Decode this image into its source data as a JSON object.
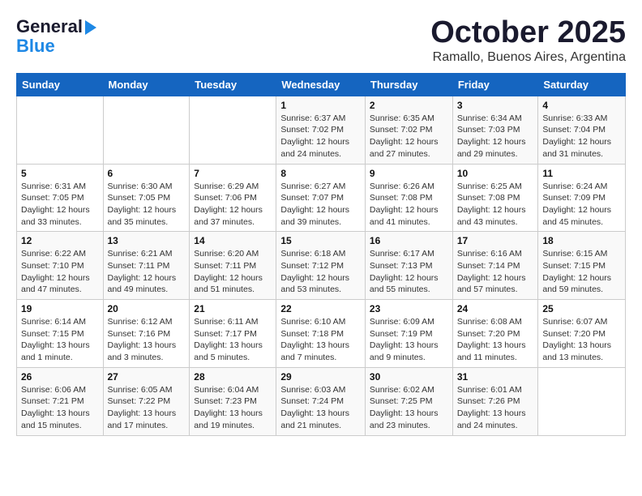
{
  "logo": {
    "line1": "General",
    "line2": "Blue"
  },
  "title": "October 2025",
  "location": "Ramallo, Buenos Aires, Argentina",
  "days_of_week": [
    "Sunday",
    "Monday",
    "Tuesday",
    "Wednesday",
    "Thursday",
    "Friday",
    "Saturday"
  ],
  "weeks": [
    [
      {
        "day": "",
        "info": ""
      },
      {
        "day": "",
        "info": ""
      },
      {
        "day": "",
        "info": ""
      },
      {
        "day": "1",
        "info": "Sunrise: 6:37 AM\nSunset: 7:02 PM\nDaylight: 12 hours and 24 minutes."
      },
      {
        "day": "2",
        "info": "Sunrise: 6:35 AM\nSunset: 7:02 PM\nDaylight: 12 hours and 27 minutes."
      },
      {
        "day": "3",
        "info": "Sunrise: 6:34 AM\nSunset: 7:03 PM\nDaylight: 12 hours and 29 minutes."
      },
      {
        "day": "4",
        "info": "Sunrise: 6:33 AM\nSunset: 7:04 PM\nDaylight: 12 hours and 31 minutes."
      }
    ],
    [
      {
        "day": "5",
        "info": "Sunrise: 6:31 AM\nSunset: 7:05 PM\nDaylight: 12 hours and 33 minutes."
      },
      {
        "day": "6",
        "info": "Sunrise: 6:30 AM\nSunset: 7:05 PM\nDaylight: 12 hours and 35 minutes."
      },
      {
        "day": "7",
        "info": "Sunrise: 6:29 AM\nSunset: 7:06 PM\nDaylight: 12 hours and 37 minutes."
      },
      {
        "day": "8",
        "info": "Sunrise: 6:27 AM\nSunset: 7:07 PM\nDaylight: 12 hours and 39 minutes."
      },
      {
        "day": "9",
        "info": "Sunrise: 6:26 AM\nSunset: 7:08 PM\nDaylight: 12 hours and 41 minutes."
      },
      {
        "day": "10",
        "info": "Sunrise: 6:25 AM\nSunset: 7:08 PM\nDaylight: 12 hours and 43 minutes."
      },
      {
        "day": "11",
        "info": "Sunrise: 6:24 AM\nSunset: 7:09 PM\nDaylight: 12 hours and 45 minutes."
      }
    ],
    [
      {
        "day": "12",
        "info": "Sunrise: 6:22 AM\nSunset: 7:10 PM\nDaylight: 12 hours and 47 minutes."
      },
      {
        "day": "13",
        "info": "Sunrise: 6:21 AM\nSunset: 7:11 PM\nDaylight: 12 hours and 49 minutes."
      },
      {
        "day": "14",
        "info": "Sunrise: 6:20 AM\nSunset: 7:11 PM\nDaylight: 12 hours and 51 minutes."
      },
      {
        "day": "15",
        "info": "Sunrise: 6:18 AM\nSunset: 7:12 PM\nDaylight: 12 hours and 53 minutes."
      },
      {
        "day": "16",
        "info": "Sunrise: 6:17 AM\nSunset: 7:13 PM\nDaylight: 12 hours and 55 minutes."
      },
      {
        "day": "17",
        "info": "Sunrise: 6:16 AM\nSunset: 7:14 PM\nDaylight: 12 hours and 57 minutes."
      },
      {
        "day": "18",
        "info": "Sunrise: 6:15 AM\nSunset: 7:15 PM\nDaylight: 12 hours and 59 minutes."
      }
    ],
    [
      {
        "day": "19",
        "info": "Sunrise: 6:14 AM\nSunset: 7:15 PM\nDaylight: 13 hours and 1 minute."
      },
      {
        "day": "20",
        "info": "Sunrise: 6:12 AM\nSunset: 7:16 PM\nDaylight: 13 hours and 3 minutes."
      },
      {
        "day": "21",
        "info": "Sunrise: 6:11 AM\nSunset: 7:17 PM\nDaylight: 13 hours and 5 minutes."
      },
      {
        "day": "22",
        "info": "Sunrise: 6:10 AM\nSunset: 7:18 PM\nDaylight: 13 hours and 7 minutes."
      },
      {
        "day": "23",
        "info": "Sunrise: 6:09 AM\nSunset: 7:19 PM\nDaylight: 13 hours and 9 minutes."
      },
      {
        "day": "24",
        "info": "Sunrise: 6:08 AM\nSunset: 7:20 PM\nDaylight: 13 hours and 11 minutes."
      },
      {
        "day": "25",
        "info": "Sunrise: 6:07 AM\nSunset: 7:20 PM\nDaylight: 13 hours and 13 minutes."
      }
    ],
    [
      {
        "day": "26",
        "info": "Sunrise: 6:06 AM\nSunset: 7:21 PM\nDaylight: 13 hours and 15 minutes."
      },
      {
        "day": "27",
        "info": "Sunrise: 6:05 AM\nSunset: 7:22 PM\nDaylight: 13 hours and 17 minutes."
      },
      {
        "day": "28",
        "info": "Sunrise: 6:04 AM\nSunset: 7:23 PM\nDaylight: 13 hours and 19 minutes."
      },
      {
        "day": "29",
        "info": "Sunrise: 6:03 AM\nSunset: 7:24 PM\nDaylight: 13 hours and 21 minutes."
      },
      {
        "day": "30",
        "info": "Sunrise: 6:02 AM\nSunset: 7:25 PM\nDaylight: 13 hours and 23 minutes."
      },
      {
        "day": "31",
        "info": "Sunrise: 6:01 AM\nSunset: 7:26 PM\nDaylight: 13 hours and 24 minutes."
      },
      {
        "day": "",
        "info": ""
      }
    ]
  ]
}
